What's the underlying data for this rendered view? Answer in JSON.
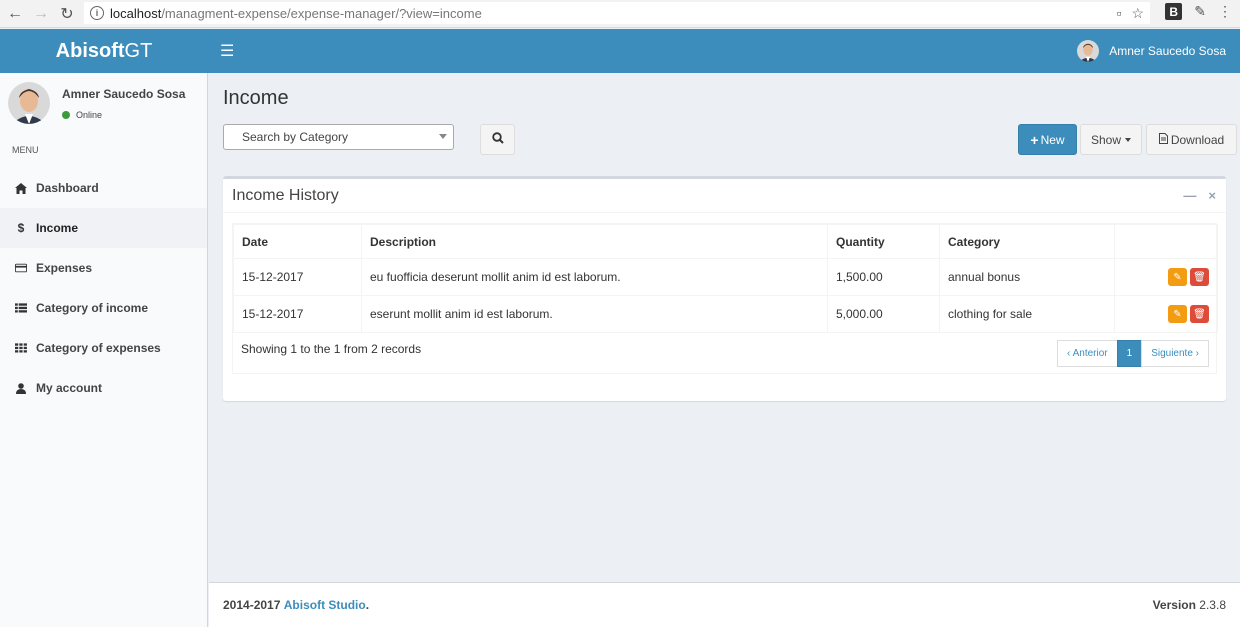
{
  "browser": {
    "url_host": "localhost",
    "url_path": "/managment-expense/expense-manager/?view=income"
  },
  "header": {
    "logo_bold": "Abisoft",
    "logo_light": "GT",
    "user_name": "Amner Saucedo Sosa"
  },
  "sidebar": {
    "user_name": "Amner Saucedo Sosa",
    "status": "Online",
    "menu_header": "MENU",
    "items": [
      {
        "label": "Dashboard",
        "icon": "home-icon",
        "active": false
      },
      {
        "label": "Income",
        "icon": "dollar-icon",
        "active": true
      },
      {
        "label": "Expenses",
        "icon": "credit-card-icon",
        "active": false
      },
      {
        "label": "Category of income",
        "icon": "list-icon",
        "active": false
      },
      {
        "label": "Category of expenses",
        "icon": "grid-icon",
        "active": false
      },
      {
        "label": "My account",
        "icon": "user-icon",
        "active": false
      }
    ]
  },
  "main": {
    "page_title": "Income",
    "search_placeholder": "Search by Category",
    "new_label": "New",
    "show_label": "Show",
    "download_label": "Download",
    "box_title": "Income History",
    "columns": [
      "Date",
      "Description",
      "Quantity",
      "Category",
      ""
    ],
    "rows": [
      {
        "date": "15-12-2017",
        "description": "eu fuofficia deserunt mollit anim id est laborum.",
        "quantity": "1,500.00",
        "category": "annual bonus"
      },
      {
        "date": "15-12-2017",
        "description": "eserunt mollit anim id est laborum.",
        "quantity": "5,000.00",
        "category": "clothing for sale"
      }
    ],
    "records_text": "Showing 1 to the 1 from 2 records",
    "pagination": {
      "prev": "‹ Anterior",
      "current": "1",
      "next": "Siguiente ›"
    }
  },
  "footer": {
    "years": "2014-2017",
    "studio": "Abisoft Studio",
    "period": ".",
    "version_label": "Version",
    "version": "2.3.8"
  },
  "colors": {
    "primary": "#3c8dbc",
    "edit": "#f39c12",
    "delete": "#dd4b39",
    "online": "#3c9b3c"
  }
}
